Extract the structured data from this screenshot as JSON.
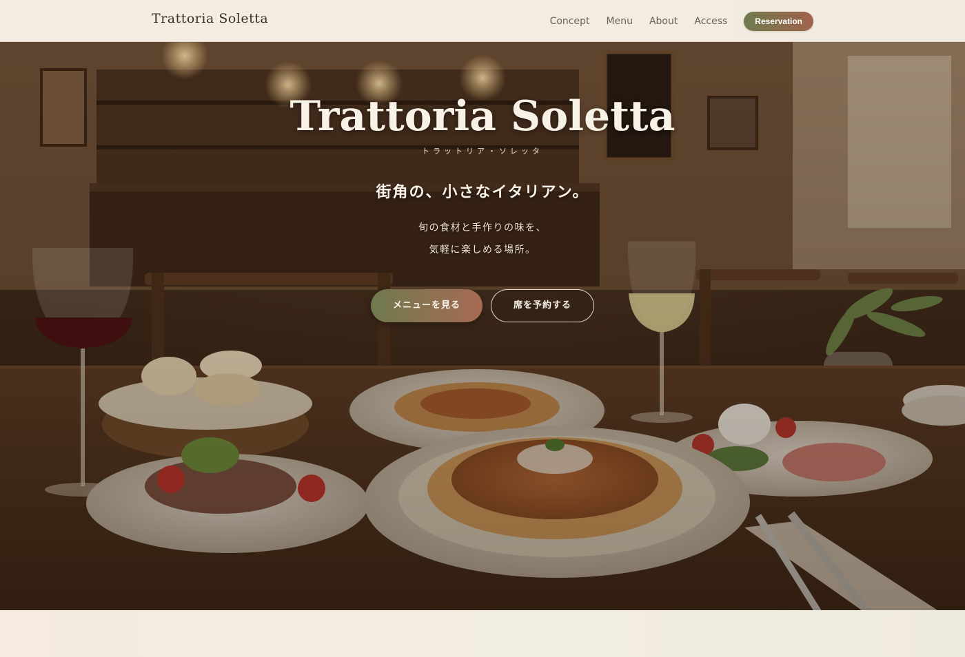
{
  "header": {
    "brand": "Trattoria Soletta",
    "nav": [
      "Concept",
      "Menu",
      "About",
      "Access"
    ],
    "cta": "Reservation"
  },
  "hero": {
    "title": "Trattoria Soletta",
    "kana": "トラットリア・ソレッタ",
    "tagline": "街角の、小さなイタリアン。",
    "description_line1": "旬の食材と手作りの味を、",
    "description_line2": "気軽に楽しめる場所。",
    "primary_button": "メニューを見る",
    "secondary_button": "席を予約する"
  },
  "colors": {
    "accent_green": "#6f7a4e",
    "accent_terracotta": "#a0624b",
    "background_cream": "#f2ebe1",
    "text_dark": "#3b2f27"
  }
}
